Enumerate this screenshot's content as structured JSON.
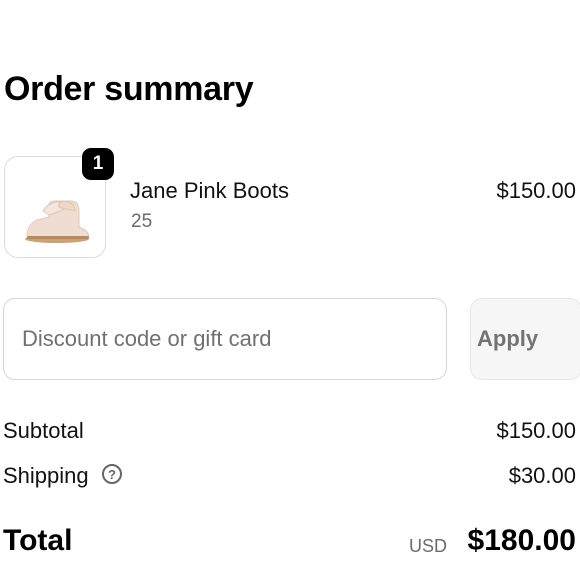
{
  "heading": "Order summary",
  "item": {
    "quantity": "1",
    "name": "Jane Pink Boots",
    "variant": "25",
    "price": "$150.00",
    "image_icon": "pink-boot-image"
  },
  "discount": {
    "placeholder": "Discount code or gift card",
    "value": "",
    "apply_label": "Apply"
  },
  "summary": {
    "subtotal_label": "Subtotal",
    "subtotal_value": "$150.00",
    "shipping_label": "Shipping",
    "shipping_help_icon": "question-circle-icon",
    "shipping_help_glyph": "?",
    "shipping_value": "$30.00",
    "total_label": "Total",
    "currency": "USD",
    "total_value": "$180.00"
  }
}
